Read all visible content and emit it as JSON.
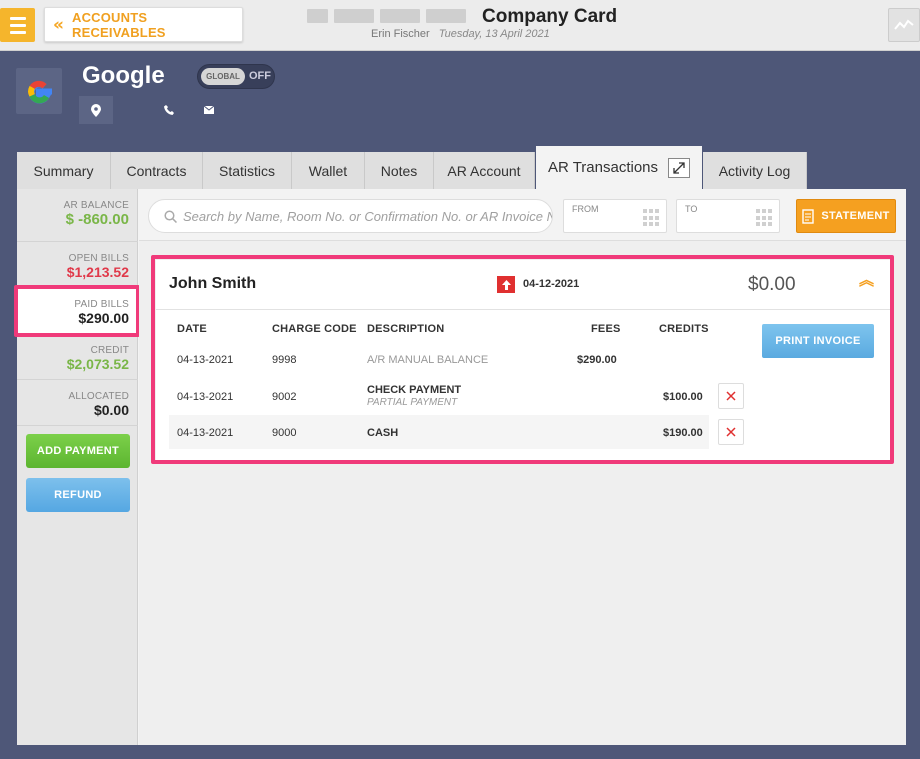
{
  "header": {
    "back_label": "ACCOUNTS RECEIVABLES",
    "title": "Company Card",
    "user": "Erin Fischer",
    "date": "Tuesday, 13 April 2021"
  },
  "company": {
    "name": "Google",
    "global_toggle": {
      "label": "GLOBAL",
      "state": "OFF"
    }
  },
  "tabs": [
    {
      "label": "Summary"
    },
    {
      "label": "Contracts"
    },
    {
      "label": "Statistics"
    },
    {
      "label": "Wallet"
    },
    {
      "label": "Notes"
    },
    {
      "label": "AR Account"
    },
    {
      "label": "AR Transactions",
      "active": true
    },
    {
      "label": "Activity Log"
    }
  ],
  "sidebar": {
    "ar_balance": {
      "label": "AR BALANCE",
      "value": "$ -860.00"
    },
    "open_bills": {
      "label": "OPEN BILLS",
      "value": "$1,213.52"
    },
    "paid_bills": {
      "label": "PAID BILLS",
      "value": "$290.00"
    },
    "credit": {
      "label": "CREDIT",
      "value": "$2,073.52"
    },
    "allocated": {
      "label": "ALLOCATED",
      "value": "$0.00"
    },
    "add_payment": "ADD PAYMENT",
    "refund": "REFUND"
  },
  "filters": {
    "search_placeholder": "Search by Name, Room No. or Confirmation No. or AR Invoice No.",
    "from_label": "FROM",
    "to_label": "TO",
    "statement_label": "STATEMENT"
  },
  "transaction": {
    "customer": "John Smith",
    "date": "04-12-2021",
    "amount": "$0.00",
    "print_label": "PRINT INVOICE",
    "columns": [
      "DATE",
      "CHARGE CODE",
      "DESCRIPTION",
      "FEES",
      "CREDITS"
    ],
    "rows": [
      {
        "date": "04-13-2021",
        "code": "9998",
        "description": "A/R MANUAL BALANCE",
        "subdescription": "",
        "fees": "$290.00",
        "credits": ""
      },
      {
        "date": "04-13-2021",
        "code": "9002",
        "description": "CHECK PAYMENT",
        "subdescription": "PARTIAL PAYMENT",
        "fees": "",
        "credits": "$100.00"
      },
      {
        "date": "04-13-2021",
        "code": "9000",
        "description": "CASH",
        "subdescription": "",
        "fees": "",
        "credits": "$190.00"
      }
    ]
  },
  "colors": {
    "accent_orange": "#f5a020",
    "highlight_pink": "#f03a7a",
    "positive_green": "#7ab648",
    "negative_red": "#e0394a",
    "background_navy": "#4e5778"
  }
}
